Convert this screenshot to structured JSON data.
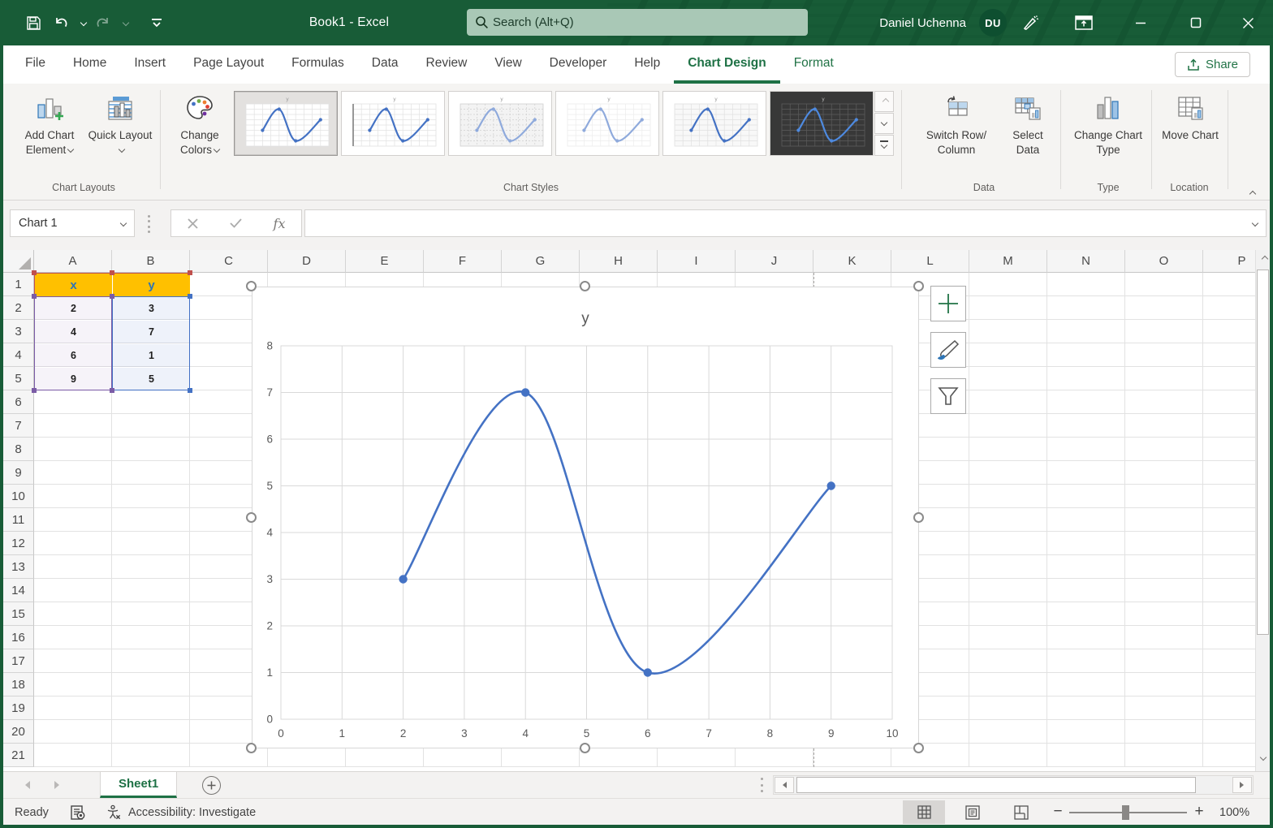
{
  "titlebar": {
    "title": "Book1 - Excel",
    "search_placeholder": "Search (Alt+Q)",
    "user_name": "Daniel Uchenna",
    "user_initials": "DU"
  },
  "menu_tabs": [
    {
      "label": "File",
      "active": false,
      "contextual": false
    },
    {
      "label": "Home",
      "active": false,
      "contextual": false
    },
    {
      "label": "Insert",
      "active": false,
      "contextual": false
    },
    {
      "label": "Page Layout",
      "active": false,
      "contextual": false
    },
    {
      "label": "Formulas",
      "active": false,
      "contextual": false
    },
    {
      "label": "Data",
      "active": false,
      "contextual": false
    },
    {
      "label": "Review",
      "active": false,
      "contextual": false
    },
    {
      "label": "View",
      "active": false,
      "contextual": false
    },
    {
      "label": "Developer",
      "active": false,
      "contextual": false
    },
    {
      "label": "Help",
      "active": false,
      "contextual": false
    },
    {
      "label": "Chart Design",
      "active": true,
      "contextual": true
    },
    {
      "label": "Format",
      "active": false,
      "contextual": true
    }
  ],
  "share": {
    "label": "Share"
  },
  "ribbon": {
    "buttons": {
      "add_chart_element": "Add Chart Element",
      "quick_layout": "Quick Layout",
      "change_colors": "Change Colors",
      "switch_row_column": "Switch Row/ Column",
      "select_data": "Select Data",
      "change_chart_type": "Change Chart Type",
      "move_chart": "Move Chart"
    },
    "group_labels": {
      "chart_layouts": "Chart Layouts",
      "chart_styles": "Chart Styles",
      "data": "Data",
      "type": "Type",
      "location": "Location"
    },
    "chart_styles_gallery": [
      {
        "name": "Style 1",
        "selected": true,
        "variant": "light"
      },
      {
        "name": "Style 2",
        "selected": false,
        "variant": "light2"
      },
      {
        "name": "Style 3",
        "selected": false,
        "variant": "dashed"
      },
      {
        "name": "Style 4",
        "selected": false,
        "variant": "plain"
      },
      {
        "name": "Style 5",
        "selected": false,
        "variant": "shaded"
      },
      {
        "name": "Style 6",
        "selected": false,
        "variant": "dark"
      }
    ]
  },
  "formula_bar": {
    "name_box": "Chart 1",
    "formula": "",
    "fx_label": "fx"
  },
  "sheet": {
    "columns": [
      "A",
      "B",
      "C",
      "D",
      "E",
      "F",
      "G",
      "H",
      "I",
      "J",
      "K",
      "L",
      "M",
      "N",
      "O",
      "P"
    ],
    "rows": [
      1,
      2,
      3,
      4,
      5,
      6,
      7,
      8,
      9,
      10,
      11,
      12,
      13,
      14,
      15,
      16,
      17,
      18,
      19,
      20,
      21
    ],
    "table": {
      "headers": [
        "x",
        "y"
      ],
      "rows": [
        [
          "2",
          "3"
        ],
        [
          "4",
          "7"
        ],
        [
          "6",
          "1"
        ],
        [
          "9",
          "5"
        ]
      ]
    }
  },
  "chart_data": {
    "type": "scatter",
    "title": "y",
    "series": [
      {
        "name": "y",
        "x": [
          2,
          4,
          6,
          9
        ],
        "y": [
          3,
          7,
          1,
          5
        ]
      }
    ],
    "xlim": [
      0,
      10
    ],
    "ylim": [
      0,
      8
    ],
    "x_ticks": [
      0,
      1,
      2,
      3,
      4,
      5,
      6,
      7,
      8,
      9,
      10
    ],
    "y_ticks": [
      0,
      1,
      2,
      3,
      4,
      5,
      6,
      7,
      8
    ],
    "grid": true,
    "smooth": true,
    "markers": true,
    "legend": "none",
    "line_color": "#4472C4",
    "grid_color": "#D9D9D9",
    "axis_text_color": "#595959",
    "title_color": "#595959"
  },
  "tabs_bar": {
    "sheet_name": "Sheet1"
  },
  "status_bar": {
    "ready": "Ready",
    "accessibility": "Accessibility: Investigate",
    "zoom_level": "100%"
  },
  "colors": {
    "titlebar_green": "#185C37",
    "active_tab_green": "#1E7145",
    "header_fill": "#FFC000",
    "header_text": "#2E75B6",
    "range_x_border": "#7B5CA6",
    "range_y_border": "#4472C4",
    "range_header_border": "#C0504D"
  }
}
